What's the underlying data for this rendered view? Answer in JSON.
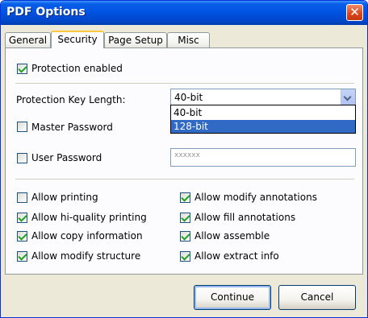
{
  "window": {
    "title": "PDF Options",
    "close_glyph": "✕"
  },
  "tabs": [
    {
      "label": "General"
    },
    {
      "label": "Security"
    },
    {
      "label": "Page Setup"
    },
    {
      "label": "Misc"
    }
  ],
  "security": {
    "protection_enabled": {
      "label": "Protection enabled",
      "checked": true
    },
    "key_length": {
      "label": "Protection Key Length:",
      "selected": "40-bit",
      "options": [
        "40-bit",
        "128-bit"
      ],
      "highlighted": "128-bit"
    },
    "master_password": {
      "label": "Master Password",
      "checked": false
    },
    "user_password": {
      "label": "User Password",
      "checked": false,
      "value": "xxxxxx"
    },
    "permissions_left": [
      {
        "label": "Allow printing",
        "checked": false
      },
      {
        "label": "Allow hi-quality printing",
        "checked": true
      },
      {
        "label": "Allow copy information",
        "checked": true
      },
      {
        "label": "Allow modify structure",
        "checked": true
      }
    ],
    "permissions_right": [
      {
        "label": "Allow modify annotations",
        "checked": true
      },
      {
        "label": "Allow fill annotations",
        "checked": true
      },
      {
        "label": "Allow assemble",
        "checked": true
      },
      {
        "label": "Allow extract info",
        "checked": true
      }
    ]
  },
  "buttons": {
    "continue": "Continue",
    "cancel": "Cancel"
  },
  "colors": {
    "titlebar": "#0054e3",
    "selection": "#316ac5",
    "dialog_bg": "#ece9d8"
  }
}
